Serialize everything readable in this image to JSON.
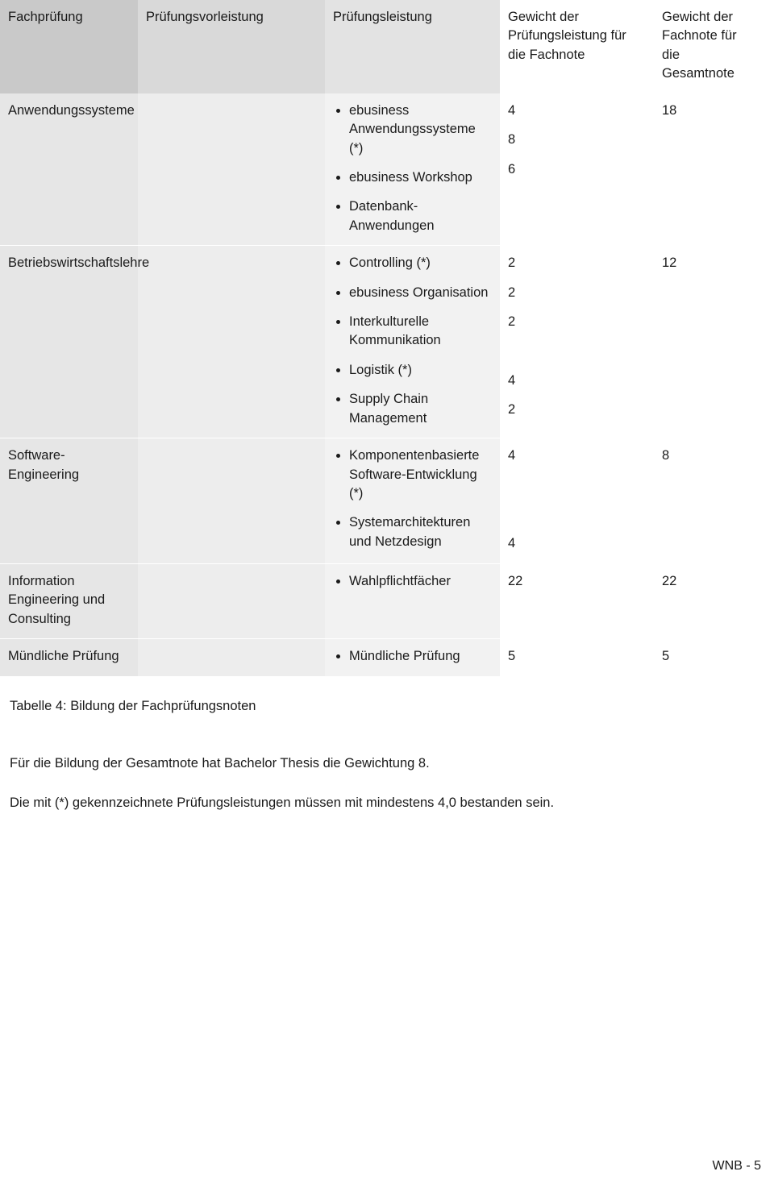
{
  "table": {
    "headers": [
      "Fachprüfung",
      "Prüfungsvorleistung",
      "Prüfungsleistung",
      "Gewicht der Prüfungsleistung für die Fachnote",
      "Gewicht der Fachnote für die Gesamtnote"
    ],
    "rows": [
      {
        "subject": "Anwendungssysteme",
        "vorleistung": "",
        "leistungen": [
          "ebusiness Anwendungssysteme (*)",
          "ebusiness Workshop",
          "Datenbank-Anwendungen"
        ],
        "gewichte": [
          "4",
          "8",
          "6"
        ],
        "fachnote": "18"
      },
      {
        "subject": "Betriebswirtschaftslehre",
        "vorleistung": "",
        "leistungen": [
          "Controlling (*)",
          "ebusiness Organisation",
          "Interkulturelle Kommunikation",
          "Logistik (*)",
          "Supply Chain Management"
        ],
        "gewichte": [
          "2",
          "2",
          "2",
          "4",
          "2"
        ],
        "fachnote": "12"
      },
      {
        "subject": "Software-Engineering",
        "vorleistung": "",
        "leistungen": [
          "Komponentenbasierte Software-Entwicklung (*)",
          "Systemarchitekturen und Netzdesign"
        ],
        "gewichte": [
          "4",
          "4"
        ],
        "fachnote": "8"
      },
      {
        "subject": "Information Engineering und Consulting",
        "vorleistung": "",
        "leistungen": [
          "Wahlpflichtfächer"
        ],
        "gewichte": [
          "22"
        ],
        "fachnote": "22"
      },
      {
        "subject": "Mündliche Prüfung",
        "vorleistung": "",
        "leistungen": [
          "Mündliche Prüfung"
        ],
        "gewichte": [
          "5"
        ],
        "fachnote": "5"
      }
    ]
  },
  "caption": "Tabelle 4: Bildung der Fachprüfungsnoten",
  "paragraph1": "Für die Bildung der Gesamtnote hat Bachelor Thesis die Gewichtung 8.",
  "paragraph2": "Die mit (*) gekennzeichnete Prüfungsleistungen müssen mit mindestens 4,0 bestanden sein.",
  "footer": "WNB - 5"
}
